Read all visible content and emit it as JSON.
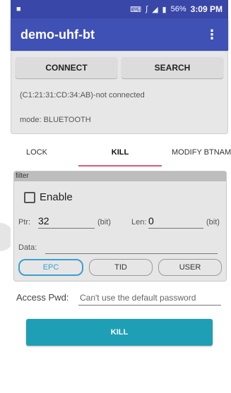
{
  "status_bar": {
    "battery": "56%",
    "time": "3:09 PM"
  },
  "app_bar": {
    "title": "demo-uhf-bt",
    "overflow_icon": "more-vert-icon"
  },
  "connection": {
    "connect_label": "CONNECT",
    "search_label": "SEARCH",
    "status_text": "(C1:21:31:CD:34:AB)-not connected",
    "mode_text": "mode: BLUETOOTH"
  },
  "tabs": [
    {
      "label": "LOCK",
      "active": false
    },
    {
      "label": "KILL",
      "active": true
    },
    {
      "label": "MODIFY BTNAM",
      "active": false
    }
  ],
  "filter": {
    "header": "filter",
    "enable_label": "Enable",
    "enable_checked": false,
    "ptr_label": "Ptr:",
    "ptr_value": "32",
    "ptr_unit": "(bit)",
    "len_label": "Len:",
    "len_value": "0",
    "len_unit": "(bit)",
    "data_label": "Data:",
    "data_value": "",
    "banks": [
      {
        "label": "EPC",
        "selected": true
      },
      {
        "label": "TID",
        "selected": false
      },
      {
        "label": "USER",
        "selected": false
      }
    ]
  },
  "access": {
    "label": "Access Pwd:",
    "placeholder": "Can't use the default password"
  },
  "kill_button_label": "KILL",
  "colors": {
    "status_bar": "#3947a8",
    "app_bar": "#3f51b5",
    "tab_indicator": "#e0567a",
    "selected_bank": "#3aa0d0",
    "kill_button": "#1f9fb5"
  }
}
